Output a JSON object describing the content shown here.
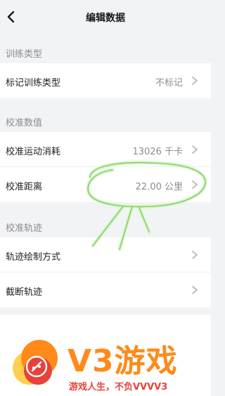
{
  "header": {
    "title": "编辑数据",
    "back_icon": "chevron-left-icon"
  },
  "sections": [
    {
      "label": "训练类型",
      "rows": [
        {
          "label": "标记训练类型",
          "value": "不标记"
        }
      ]
    },
    {
      "label": "校准数值",
      "rows": [
        {
          "label": "校准运动消耗",
          "value": "13026 千卡"
        },
        {
          "label": "校准距离",
          "value": "22.00 公里"
        }
      ]
    },
    {
      "label": "校准轨迹",
      "rows": [
        {
          "label": "轨迹绘制方式",
          "value": ""
        },
        {
          "label": "截断轨迹",
          "value": ""
        }
      ]
    }
  ],
  "watermark": {
    "brand": "V3游戏",
    "slogan": "游戏人生，不负VVVV3",
    "colors": {
      "brand": "#ff8a1a",
      "slogan": "#e8413a"
    }
  },
  "annotation": {
    "stroke_color": "#b9f0a0",
    "shape": "hand-drawn circle highlighting 校准距离 value"
  }
}
